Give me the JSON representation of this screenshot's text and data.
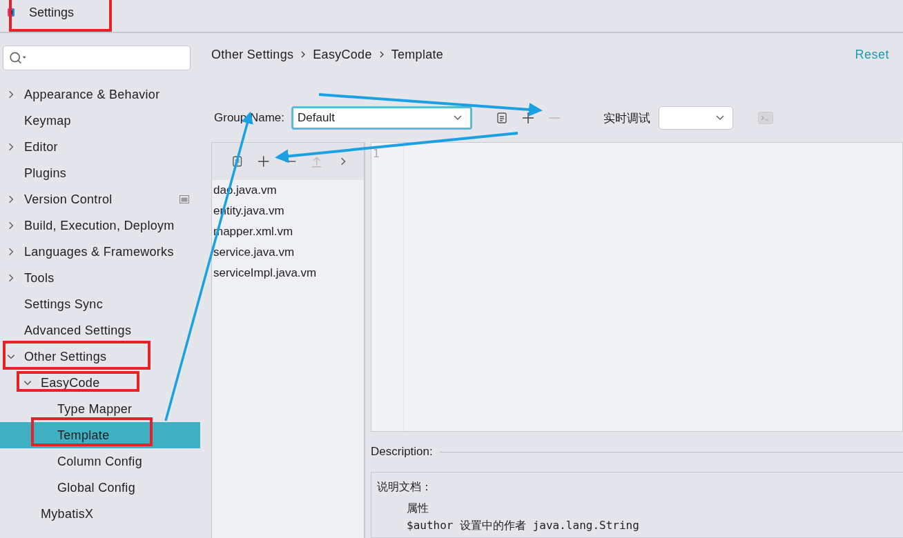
{
  "window": {
    "title": "Settings"
  },
  "sidebar": {
    "items": [
      {
        "label": "Appearance & Behavior",
        "expanded": false,
        "selected": false
      },
      {
        "label": "Keymap",
        "selected": false
      },
      {
        "label": "Editor",
        "expanded": false,
        "selected": false
      },
      {
        "label": "Plugins",
        "selected": false
      },
      {
        "label": "Version Control",
        "expanded": false,
        "selected": false,
        "project_icon": true
      },
      {
        "label": "Build, Execution, Deploym",
        "expanded": false,
        "selected": false
      },
      {
        "label": "Languages & Frameworks",
        "expanded": false,
        "selected": false
      },
      {
        "label": "Tools",
        "expanded": false,
        "selected": false
      },
      {
        "label": "Settings Sync",
        "selected": false
      },
      {
        "label": "Advanced Settings",
        "selected": false
      },
      {
        "label": "Other Settings",
        "expanded": true,
        "selected": false,
        "children": [
          {
            "label": "EasyCode",
            "expanded": true,
            "selected": false,
            "children": [
              {
                "label": "Type Mapper",
                "selected": false
              },
              {
                "label": "Template",
                "selected": true
              },
              {
                "label": "Column Config",
                "selected": false
              },
              {
                "label": "Global Config",
                "selected": false
              }
            ]
          },
          {
            "label": "MybatisX",
            "selected": false
          }
        ]
      }
    ]
  },
  "breadcrumb": [
    "Other Settings",
    "EasyCode",
    "Template"
  ],
  "reset": "Reset",
  "group": {
    "label": "Group Name:",
    "value": "Default",
    "debug_label": "实时调试"
  },
  "templates": {
    "files": [
      {
        "name": "dao.java.vm",
        "selected": false
      },
      {
        "name": "entity.java.vm",
        "selected": false
      },
      {
        "name": "mapper.xml.vm",
        "selected": false
      },
      {
        "name": "service.java.vm",
        "selected": false
      },
      {
        "name": "serviceImpl.java.vm",
        "selected": false
      }
    ]
  },
  "editor": {
    "line_numbers": [
      "1"
    ]
  },
  "description": {
    "label": "Description:",
    "lines": [
      {
        "kind": "heading",
        "text": "说明文档："
      },
      {
        "kind": "section",
        "text": "属性"
      },
      {
        "kind": "code",
        "text": "$author 设置中的作者 java.lang.String"
      }
    ]
  }
}
